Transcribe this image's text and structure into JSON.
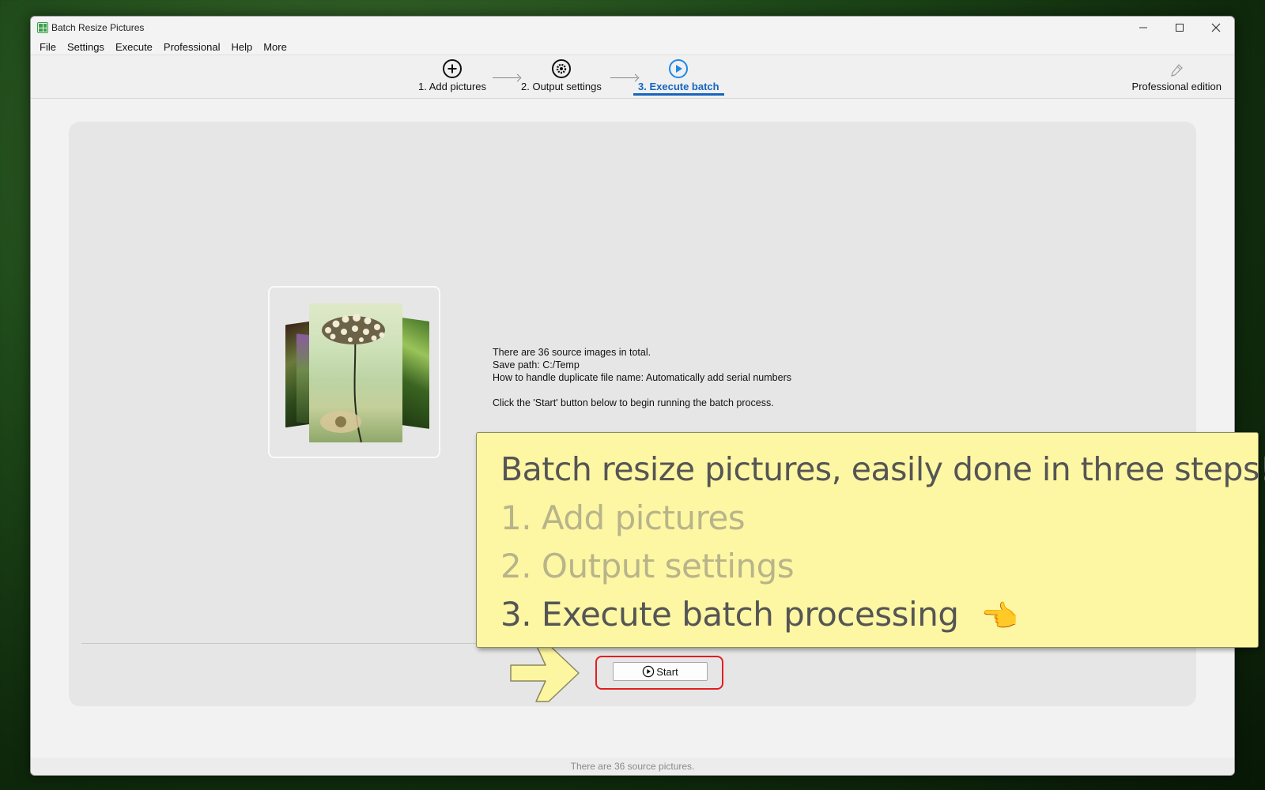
{
  "window": {
    "title": "Batch Resize Pictures"
  },
  "menu": [
    "File",
    "Settings",
    "Execute",
    "Professional",
    "Help",
    "More"
  ],
  "steps": [
    {
      "label": "1. Add pictures",
      "icon": "plus-circle-icon",
      "active": false
    },
    {
      "label": "2. Output settings",
      "icon": "gear-circle-icon",
      "active": false
    },
    {
      "label": "3. Execute batch",
      "icon": "play-circle-icon",
      "active": true
    }
  ],
  "edition": {
    "label": "Professional edition",
    "icon": "pen-icon"
  },
  "summary": {
    "total": "There are 36 source images in total.",
    "save_path": "Save path: C:/Temp",
    "duplicate": "How to handle duplicate file name: Automatically add serial numbers",
    "instruction": "Click the 'Start' button below to begin running the batch process."
  },
  "start_button": {
    "label": "Start",
    "icon": "play-circle-icon"
  },
  "status": "There are 36 source pictures.",
  "callout": {
    "headline": "Batch resize pictures, easily done in three steps!",
    "step1": "1. Add pictures",
    "step2": "2. Output settings",
    "step3": "3. Execute batch processing",
    "hand_icon": "pointing-hand-icon"
  },
  "colors": {
    "accent": "#1565c0",
    "highlight_border": "#e21e1e",
    "callout_bg": "#fdf7a3",
    "arrow_fill": "#fcf6a0"
  }
}
